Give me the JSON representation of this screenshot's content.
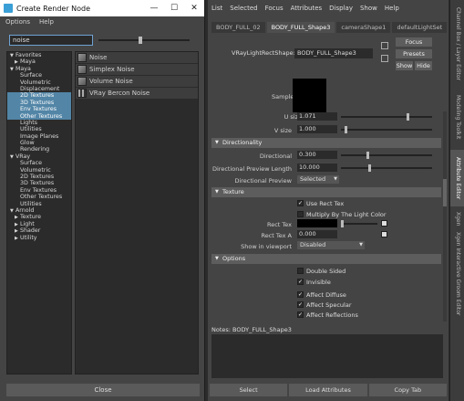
{
  "render_node": {
    "title": "Create Render Node",
    "window_buttons": [
      "—",
      "☐",
      "✕"
    ],
    "menu": [
      "Options",
      "Help"
    ],
    "search_value": "noise",
    "tree": [
      {
        "label": "Favorites",
        "level": 0,
        "expand": "▼",
        "selected": false
      },
      {
        "label": "Maya",
        "level": 1,
        "expand": "▶",
        "selected": false
      },
      {
        "label": "Maya",
        "level": 0,
        "expand": "▼",
        "selected": false
      },
      {
        "label": "Surface",
        "level": 1,
        "expand": "",
        "selected": false
      },
      {
        "label": "Volumetric",
        "level": 1,
        "expand": "",
        "selected": false
      },
      {
        "label": "Displacement",
        "level": 1,
        "expand": "",
        "selected": false
      },
      {
        "label": "2D Textures",
        "level": 1,
        "expand": "",
        "selected": true
      },
      {
        "label": "3D Textures",
        "level": 1,
        "expand": "",
        "selected": true
      },
      {
        "label": "Env Textures",
        "level": 1,
        "expand": "",
        "selected": true
      },
      {
        "label": "Other Textures",
        "level": 1,
        "expand": "",
        "selected": true
      },
      {
        "label": "Lights",
        "level": 1,
        "expand": "",
        "selected": false
      },
      {
        "label": "Utilities",
        "level": 1,
        "expand": "",
        "selected": false
      },
      {
        "label": "Image Planes",
        "level": 1,
        "expand": "",
        "selected": false
      },
      {
        "label": "Glow",
        "level": 1,
        "expand": "",
        "selected": false
      },
      {
        "label": "Rendering",
        "level": 1,
        "expand": "",
        "selected": false
      },
      {
        "label": "VRay",
        "level": 0,
        "expand": "▼",
        "selected": false
      },
      {
        "label": "Surface",
        "level": 1,
        "expand": "",
        "selected": false
      },
      {
        "label": "Volumetric",
        "level": 1,
        "expand": "",
        "selected": false
      },
      {
        "label": "2D Textures",
        "level": 1,
        "expand": "",
        "selected": false
      },
      {
        "label": "3D Textures",
        "level": 1,
        "expand": "",
        "selected": false
      },
      {
        "label": "Env Textures",
        "level": 1,
        "expand": "",
        "selected": false
      },
      {
        "label": "Other Textures",
        "level": 1,
        "expand": "",
        "selected": false
      },
      {
        "label": "Utilities",
        "level": 1,
        "expand": "",
        "selected": false
      },
      {
        "label": "Arnold",
        "level": 0,
        "expand": "▼",
        "selected": false
      },
      {
        "label": "Texture",
        "level": 1,
        "expand": "▶",
        "selected": false
      },
      {
        "label": "Light",
        "level": 1,
        "expand": "▶",
        "selected": false
      },
      {
        "label": "Shader",
        "level": 1,
        "expand": "▶",
        "selected": false
      },
      {
        "label": "Utility",
        "level": 1,
        "expand": "▶",
        "selected": false
      }
    ],
    "nodes": [
      "Noise",
      "Simplex Noise",
      "Volume Noise",
      "VRay Bercon Noise"
    ],
    "close_label": "Close"
  },
  "attribute_editor": {
    "menu": [
      "List",
      "Selected",
      "Focus",
      "Attributes",
      "Display",
      "Show",
      "Help"
    ],
    "tabs": [
      "BODY_FULL_02",
      "BODY_FULL_Shape3",
      "cameraShape1",
      "defaultLightSet"
    ],
    "active_tab": 1,
    "node_type_label": "VRayLightRectShape:",
    "node_name": "BODY_FULL_Shape3",
    "focus_label": "Focus",
    "presets_label": "Presets",
    "show_label": "Show",
    "hide_label": "Hide",
    "sample_label": "Sample",
    "u_size_label": "U size",
    "u_size_value": "1.071",
    "v_size_label": "V size",
    "v_size_value": "1.000",
    "sections": {
      "directionality": {
        "title": "Directionality",
        "directional_label": "Directional",
        "directional_value": "0.300",
        "preview_length_label": "Directional Preview Length",
        "preview_length_value": "10.000",
        "preview_label": "Directional Preview",
        "preview_value": "Selected"
      },
      "texture": {
        "title": "Texture",
        "use_rect_tex": "Use Rect Tex",
        "multiply_label": "Multiply By The Light Color",
        "rect_tex_label": "Rect Tex",
        "rect_tex_a_label": "Rect Tex A",
        "rect_tex_a_value": "0.000",
        "show_viewport_label": "Show in viewport",
        "show_viewport_value": "Disabled"
      },
      "options": {
        "title": "Options",
        "double_sided": "Double Sided",
        "invisible": "Invisible",
        "affect_diffuse": "Affect Diffuse",
        "affect_specular": "Affect Specular",
        "affect_reflections": "Affect Reflections"
      }
    },
    "notes_label": "Notes:  BODY_FULL_Shape3",
    "bottom_buttons": [
      "Select",
      "Load Attributes",
      "Copy Tab"
    ]
  },
  "side_tabs": [
    "Channel Box / Layer Editor",
    "Modeling Toolkit",
    "Attribute Editor",
    "Xgen",
    "Xgen Interactive Groom Editor"
  ]
}
